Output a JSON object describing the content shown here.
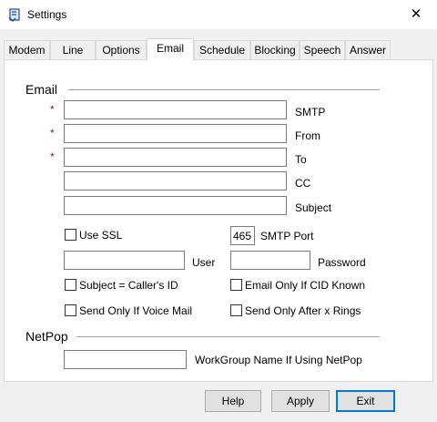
{
  "window": {
    "title": "Settings",
    "close_glyph": "✕",
    "icon": "settings-app-icon"
  },
  "tabs": [
    {
      "label": "Modem"
    },
    {
      "label": "Line"
    },
    {
      "label": "Options"
    },
    {
      "label": "Email",
      "active": true
    },
    {
      "label": "Schedule"
    },
    {
      "label": "Blocking"
    },
    {
      "label": "Speech"
    },
    {
      "label": "Answer"
    }
  ],
  "email": {
    "group_label": "Email",
    "required_marker": "*",
    "smtp_label": "SMTP",
    "from_label": "From",
    "to_label": "To",
    "cc_label": "CC",
    "subject_label": "Subject",
    "smtp_value": "",
    "from_value": "",
    "to_value": "",
    "cc_value": "",
    "subject_value": "",
    "use_ssl_label": "Use SSL",
    "use_ssl_checked": false,
    "smtp_port_value": "465",
    "smtp_port_label": "SMTP Port",
    "user_label": "User",
    "user_value": "",
    "password_label": "Password",
    "password_value": "",
    "subject_caller_label": "Subject = Caller's ID",
    "subject_caller_checked": false,
    "email_only_cid_label": "Email Only If CID Known",
    "email_only_cid_checked": false,
    "send_voice_mail_label": "Send Only If Voice Mail",
    "send_voice_mail_checked": false,
    "send_after_rings_label": "Send Only After x Rings",
    "send_after_rings_checked": false
  },
  "netpop": {
    "group_label": "NetPop",
    "workgroup_label": "WorkGroup Name If Using NetPop",
    "workgroup_value": ""
  },
  "buttons": {
    "help": "Help",
    "apply": "Apply",
    "exit": "Exit"
  },
  "colors": {
    "accent": "#0078d7",
    "required": "#c00000"
  }
}
